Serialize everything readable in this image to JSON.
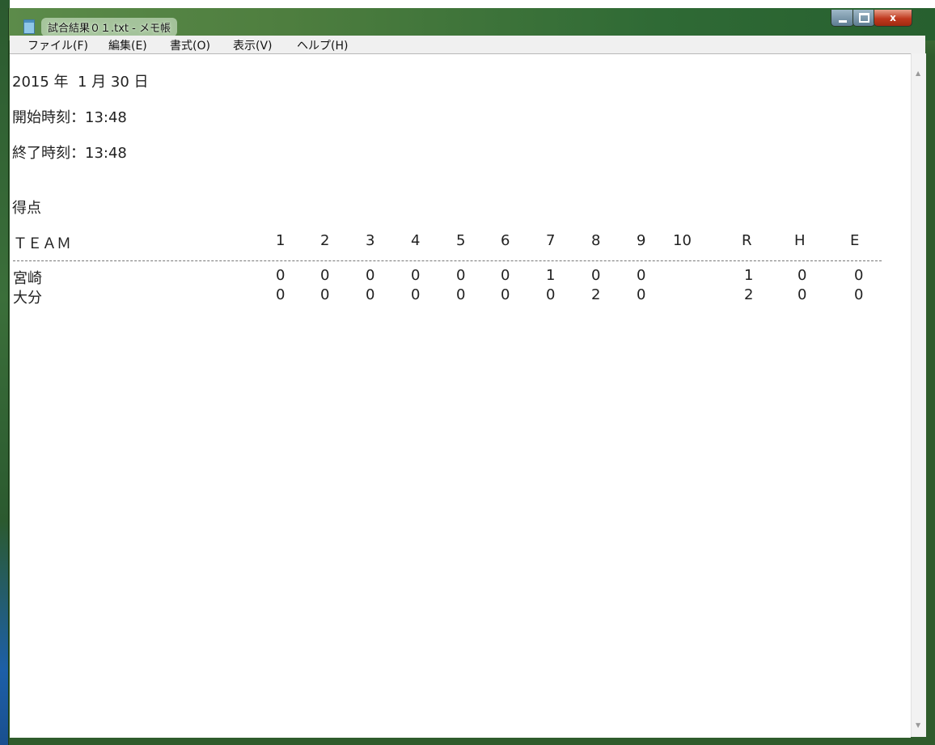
{
  "window": {
    "title": "試合結果０１.txt - メモ帳",
    "controls": {
      "minimize": "minimize",
      "maximize": "maximize",
      "close": "x"
    }
  },
  "menu": {
    "file": "ファイル(F)",
    "edit": "編集(E)",
    "format": "書式(O)",
    "view": "表示(V)",
    "help": "ヘルプ(H)"
  },
  "document": {
    "date": "2015 年  1 月 30 日",
    "start_time": "開始時刻：13:48",
    "end_time": "終了時刻：13:48",
    "score_heading": "得点",
    "table": {
      "header": [
        "ＴＥＡＭ",
        "1",
        "2",
        "3",
        "4",
        "5",
        "6",
        "7",
        "8",
        "9",
        "10",
        "R",
        "H",
        "E"
      ],
      "rows": [
        {
          "team": "宮崎",
          "innings": [
            "0",
            "0",
            "0",
            "0",
            "0",
            "0",
            "1",
            "0",
            "0",
            ""
          ],
          "R": "1",
          "H": "0",
          "E": "0"
        },
        {
          "team": "大分",
          "innings": [
            "0",
            "0",
            "0",
            "0",
            "0",
            "0",
            "0",
            "2",
            "0",
            ""
          ],
          "R": "2",
          "H": "0",
          "E": "0"
        }
      ]
    }
  },
  "icons": {
    "app": "notepad-icon",
    "scroll_up": "scroll-up-arrow-icon",
    "scroll_down": "scroll-down-arrow-icon"
  }
}
